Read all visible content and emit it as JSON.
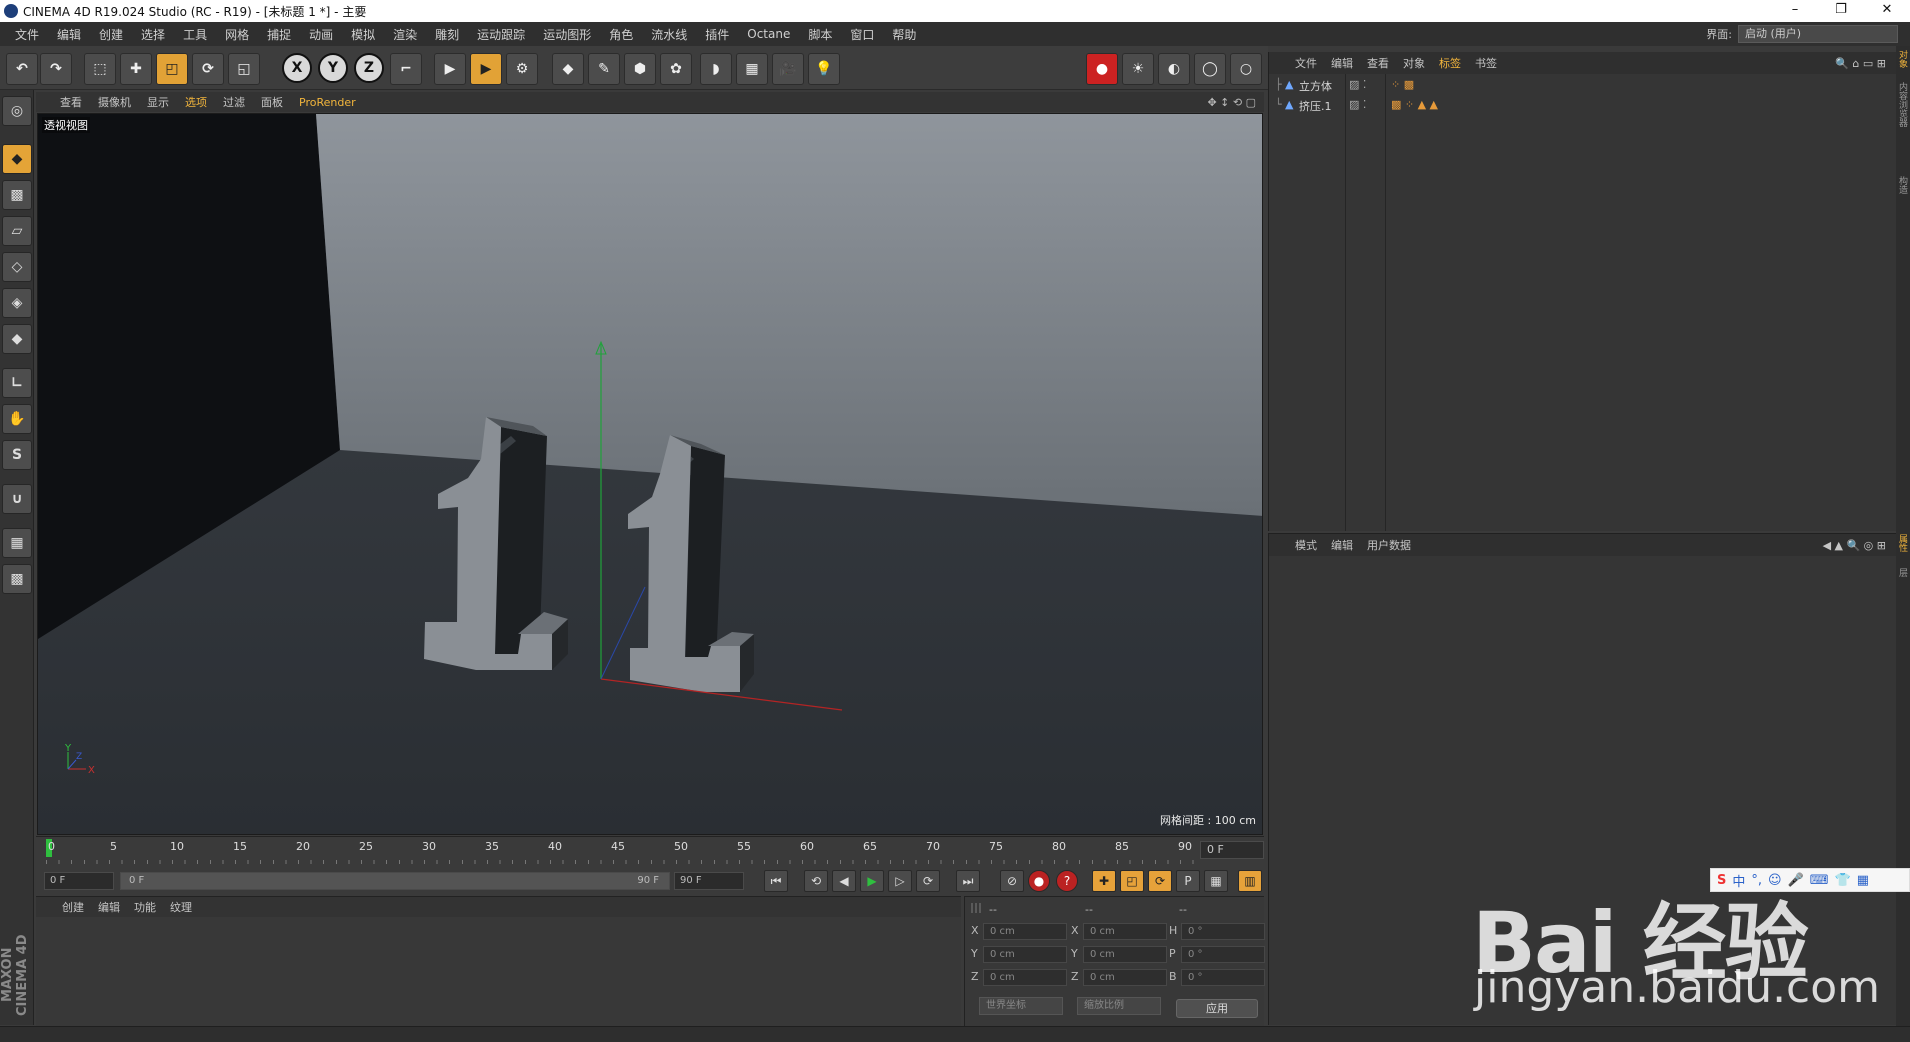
{
  "window": {
    "title": "CINEMA 4D R19.024 Studio (RC - R19) - [未标题 1 *] - 主要",
    "controls": [
      "–",
      "❐",
      "✕"
    ]
  },
  "menubar": {
    "items": [
      "文件",
      "编辑",
      "创建",
      "选择",
      "工具",
      "网格",
      "捕捉",
      "动画",
      "模拟",
      "渲染",
      "雕刻",
      "运动跟踪",
      "运动图形",
      "角色",
      "流水线",
      "插件",
      "Octane",
      "脚本",
      "窗口",
      "帮助"
    ],
    "layout_label": "界面:",
    "layout_value": "启动 (用户)"
  },
  "viewport": {
    "menu": [
      "查看",
      "摄像机",
      "显示",
      "选项",
      "过滤",
      "面板",
      "ProRender"
    ],
    "active_menu": "选项",
    "name": "透视视图",
    "grid_spacing": "网格间距 : 100 cm"
  },
  "timeline": {
    "ticks": [
      "0",
      "5",
      "10",
      "15",
      "20",
      "25",
      "30",
      "35",
      "40",
      "45",
      "50",
      "55",
      "60",
      "65",
      "70",
      "75",
      "80",
      "85",
      "90"
    ],
    "end_frame": "0 F",
    "current": "0 F",
    "range_start": "0 F",
    "range_end": "90 F",
    "max": "90 F"
  },
  "material_manager": {
    "menu": [
      "创建",
      "编辑",
      "功能",
      "纹理"
    ]
  },
  "coordinates": {
    "headers": [
      "--",
      "--",
      "--"
    ],
    "rows": [
      {
        "a": "X",
        "av": "0 cm",
        "b": "X",
        "bv": "0 cm",
        "c": "H",
        "cv": "0 °"
      },
      {
        "a": "Y",
        "av": "0 cm",
        "b": "Y",
        "bv": "0 cm",
        "c": "P",
        "cv": "0 °"
      },
      {
        "a": "Z",
        "av": "0 cm",
        "b": "Z",
        "bv": "0 cm",
        "c": "B",
        "cv": "0 °"
      }
    ],
    "coord_mode": "世界坐标",
    "scale_mode": "缩放比例",
    "apply": "应用"
  },
  "object_manager": {
    "menu": [
      "文件",
      "编辑",
      "查看",
      "对象",
      "标签",
      "书签"
    ],
    "active_menu": "标签",
    "objects": [
      "立方体",
      "挤压.1"
    ]
  },
  "attribute_manager": {
    "menu": [
      "模式",
      "编辑",
      "用户数据"
    ]
  },
  "right_strip": [
    "对象",
    "内容浏览器",
    "构造",
    "属性",
    "层"
  ],
  "logo": {
    "text": "MAXON CINEMA 4D"
  },
  "watermark": {
    "main": "Bai 经验",
    "sub": "jingyan.baidu.com"
  },
  "ime": {
    "label": "中"
  },
  "colors": {
    "accent": "#f2b53c",
    "toolbar_highlight": "#e2a236",
    "viewport_bg": "#2f3337"
  }
}
